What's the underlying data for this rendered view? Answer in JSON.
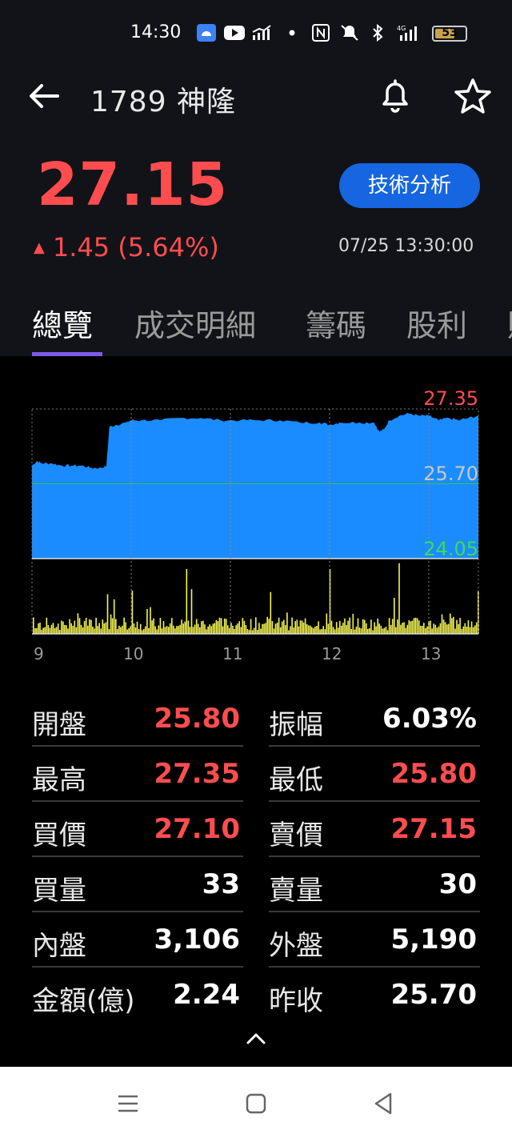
{
  "status_bar": {
    "time": "14:30",
    "battery": "53",
    "network": "4G"
  },
  "header": {
    "title": "1789 神隆"
  },
  "quote": {
    "price": "27.15",
    "change": "1.45 (5.64%)",
    "change_direction": "up",
    "timestamp": "07/25 13:30:00",
    "tech_button": "技術分析"
  },
  "tabs": [
    {
      "label": "總覽",
      "active": true
    },
    {
      "label": "成交明細",
      "active": false
    },
    {
      "label": "籌碼",
      "active": false
    },
    {
      "label": "股利",
      "active": false
    }
  ],
  "colors": {
    "up": "#ff4d4f",
    "down": "#3ddc53",
    "neutral": "#ffffff",
    "area": "#1a8cff",
    "volume": "#f5f550",
    "accent": "#1566e0",
    "tab_indicator": "#7b5ce8"
  },
  "chart_data": {
    "type": "area",
    "y_max_label": "27.35",
    "y_mid_label": "25.70",
    "y_min_label": "24.05",
    "ylim": [
      24.05,
      27.35
    ],
    "reference": 25.7,
    "x_ticks": [
      "9",
      "10",
      "11",
      "12",
      "13"
    ],
    "x_range_hours": [
      9,
      13.5
    ],
    "price_series": [
      [
        9.0,
        26.1
      ],
      [
        9.05,
        26.2
      ],
      [
        9.1,
        26.15
      ],
      [
        9.2,
        26.15
      ],
      [
        9.3,
        26.1
      ],
      [
        9.4,
        26.1
      ],
      [
        9.5,
        26.1
      ],
      [
        9.6,
        26.05
      ],
      [
        9.7,
        26.05
      ],
      [
        9.75,
        26.1
      ],
      [
        9.78,
        26.95
      ],
      [
        9.85,
        27.0
      ],
      [
        9.95,
        27.05
      ],
      [
        10.0,
        27.1
      ],
      [
        10.1,
        27.1
      ],
      [
        10.3,
        27.1
      ],
      [
        10.5,
        27.15
      ],
      [
        10.7,
        27.15
      ],
      [
        10.9,
        27.1
      ],
      [
        11.1,
        27.1
      ],
      [
        11.3,
        27.1
      ],
      [
        11.5,
        27.1
      ],
      [
        11.7,
        27.05
      ],
      [
        11.9,
        27.05
      ],
      [
        12.0,
        27.0
      ],
      [
        12.1,
        27.05
      ],
      [
        12.3,
        27.05
      ],
      [
        12.45,
        27.05
      ],
      [
        12.5,
        26.85
      ],
      [
        12.55,
        26.9
      ],
      [
        12.6,
        27.1
      ],
      [
        12.7,
        27.2
      ],
      [
        12.8,
        27.25
      ],
      [
        12.9,
        27.2
      ],
      [
        13.0,
        27.2
      ],
      [
        13.1,
        27.1
      ],
      [
        13.2,
        27.15
      ],
      [
        13.3,
        27.1
      ],
      [
        13.4,
        27.15
      ],
      [
        13.5,
        27.2
      ]
    ],
    "volume_max": 100,
    "volume_peaks": [
      [
        9.75,
        55
      ],
      [
        9.82,
        48
      ],
      [
        10.0,
        60
      ],
      [
        10.55,
        90
      ],
      [
        10.6,
        62
      ],
      [
        11.4,
        58
      ],
      [
        12.0,
        90
      ],
      [
        12.7,
        98
      ],
      [
        12.65,
        50
      ],
      [
        13.5,
        60
      ]
    ]
  },
  "stats": [
    {
      "left": {
        "label": "開盤",
        "value": "25.80",
        "color": "up"
      },
      "right": {
        "label": "振幅",
        "value": "6.03%",
        "color": "neutral"
      }
    },
    {
      "left": {
        "label": "最高",
        "value": "27.35",
        "color": "up"
      },
      "right": {
        "label": "最低",
        "value": "25.80",
        "color": "up"
      }
    },
    {
      "left": {
        "label": "買價",
        "value": "27.10",
        "color": "up"
      },
      "right": {
        "label": "賣價",
        "value": "27.15",
        "color": "up"
      }
    },
    {
      "left": {
        "label": "買量",
        "value": "33",
        "color": "neutral"
      },
      "right": {
        "label": "賣量",
        "value": "30",
        "color": "neutral"
      }
    },
    {
      "left": {
        "label": "內盤",
        "value": "3,106",
        "color": "neutral"
      },
      "right": {
        "label": "外盤",
        "value": "5,190",
        "color": "neutral"
      }
    },
    {
      "left": {
        "label": "金額(億)",
        "value": "2.24",
        "color": "neutral"
      },
      "right": {
        "label": "昨收",
        "value": "25.70",
        "color": "neutral"
      }
    }
  ],
  "icons": [
    "back-arrow-icon",
    "bell-icon",
    "star-icon",
    "chevron-up-icon",
    "menu-icon",
    "home-square-icon",
    "back-triangle-icon"
  ]
}
